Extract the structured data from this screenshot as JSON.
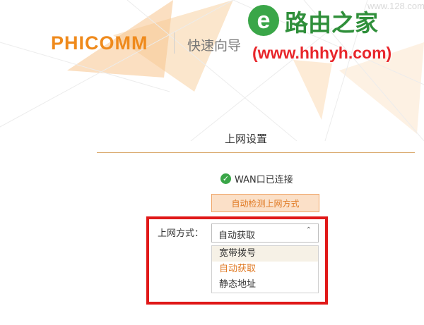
{
  "header": {
    "logo": "PHICOMM",
    "wizard_title": "快速向导"
  },
  "watermark": {
    "icon_glyph": "e",
    "brand": "路由之家",
    "url": "(www.hhhyh.com)",
    "faint_text": "www.128.com"
  },
  "section": {
    "title": "上网设置"
  },
  "status": {
    "icon": "check-circle-icon",
    "icon_glyph": "✓",
    "text": "WAN口已连接"
  },
  "detect_button": {
    "label": "自动检测上网方式"
  },
  "mode_select": {
    "label": "上网方式：",
    "value": "自动获取",
    "caret": "⌃",
    "options": [
      "宽带拨号",
      "自动获取",
      "静态地址"
    ],
    "hovered_index": 0,
    "selected_index": 1
  },
  "colors": {
    "brand_orange": "#ef8a1c",
    "accent_orange": "#e07a24",
    "watermark_green": "#2f8f3a",
    "watermark_red": "#e8262b",
    "annotation_red": "#e01818"
  }
}
